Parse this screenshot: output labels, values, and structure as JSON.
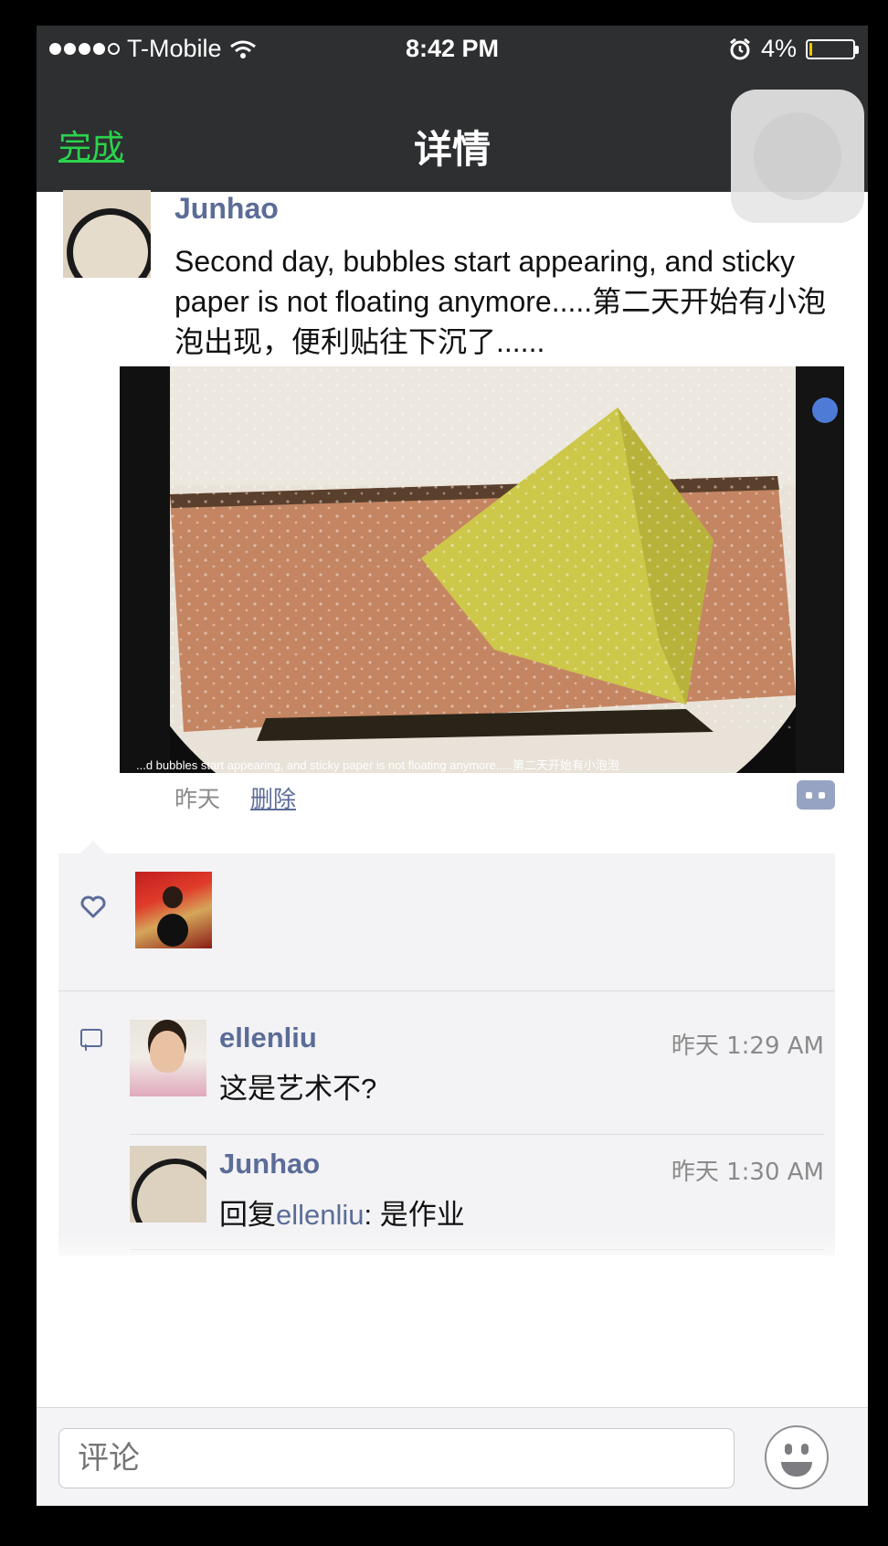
{
  "status_bar": {
    "carrier": "T-Mobile",
    "time": "8:42 PM",
    "battery": "4%",
    "battery_level": 0.04,
    "icons": [
      "signal-dots-icon",
      "wifi-icon",
      "alarm-icon",
      "battery-icon"
    ]
  },
  "nav": {
    "done_label": "完成",
    "title": "详情"
  },
  "post": {
    "author": "Junhao",
    "text": "Second day, bubbles start appearing, and sticky paper is not floating anymore.....第二天开始有小泡泡出现，便利贴往下沉了......",
    "image_caption": "...d bubbles start appearing, and sticky paper is not floating anymore.....第二天开始有小泡泡",
    "time": "昨天",
    "delete_label": "删除"
  },
  "likes": {
    "icon": "heart-icon"
  },
  "comments": [
    {
      "name": "ellenliu",
      "time": "昨天 1:29 AM",
      "text": "这是艺术不?"
    },
    {
      "name": "Junhao",
      "time": "昨天 1:30 AM",
      "reply_prefix": "回复",
      "reply_to": "ellenliu",
      "reply_text": ": 是作业"
    }
  ],
  "input": {
    "placeholder": "评论"
  },
  "colors": {
    "nav_bg": "#2e2f31",
    "accent_green": "#2bd34c",
    "link_blue": "#5b6c98",
    "panel_bg": "#f3f3f5"
  }
}
